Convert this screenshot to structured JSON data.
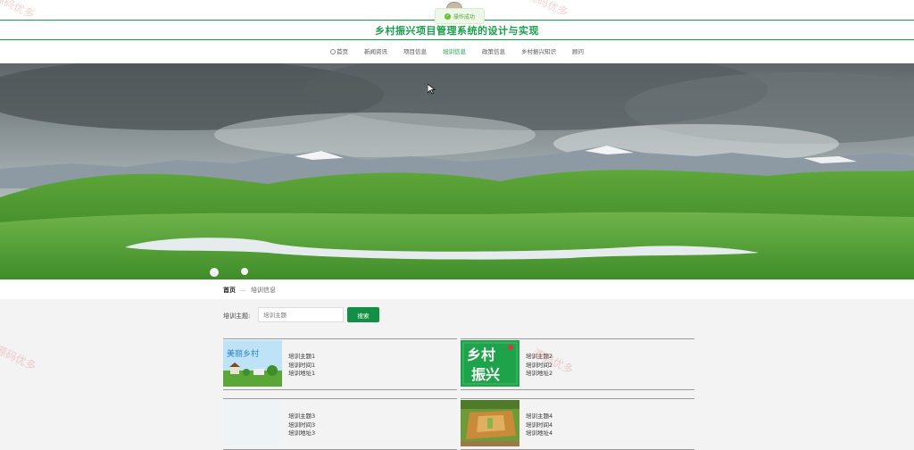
{
  "header": {
    "title": "乡村振兴项目管理系统的设计与实现",
    "toast": "操作成功"
  },
  "nav": {
    "items": [
      {
        "label": "首页"
      },
      {
        "label": "新闻资讯"
      },
      {
        "label": "项目信息"
      },
      {
        "label": "培训信息"
      },
      {
        "label": "政策信息"
      },
      {
        "label": "乡村振兴知识"
      },
      {
        "label": "顾问"
      }
    ],
    "active_index": 3
  },
  "breadcrumb": {
    "home": "首页",
    "separator": "—",
    "current": "培训信息"
  },
  "search": {
    "label": "培训主题:",
    "placeholder": "培训主题",
    "button": "搜索"
  },
  "cards": [
    {
      "topic": "培训主题1",
      "time": "培训时间1",
      "address": "培训地址1",
      "image": "beautiful-village-thumbnail"
    },
    {
      "topic": "培训主题2",
      "time": "培训时间2",
      "address": "培训地址2",
      "image": "rural-revitalization-calligraphy-thumbnail"
    },
    {
      "topic": "培训主题3",
      "time": "培训时间3",
      "address": "培训地址3",
      "image": "blank-thumbnail"
    },
    {
      "topic": "培训主题4",
      "time": "培训时间4",
      "address": "培训地址4",
      "image": "farmland-aerial-thumbnail"
    }
  ],
  "thumb_text": {
    "card1": "美丽乡村",
    "card2_a": "乡村",
    "card2_b": "振兴"
  },
  "watermark": "源码优多",
  "colors": {
    "accent": "#17a04a",
    "button": "#138e45"
  }
}
